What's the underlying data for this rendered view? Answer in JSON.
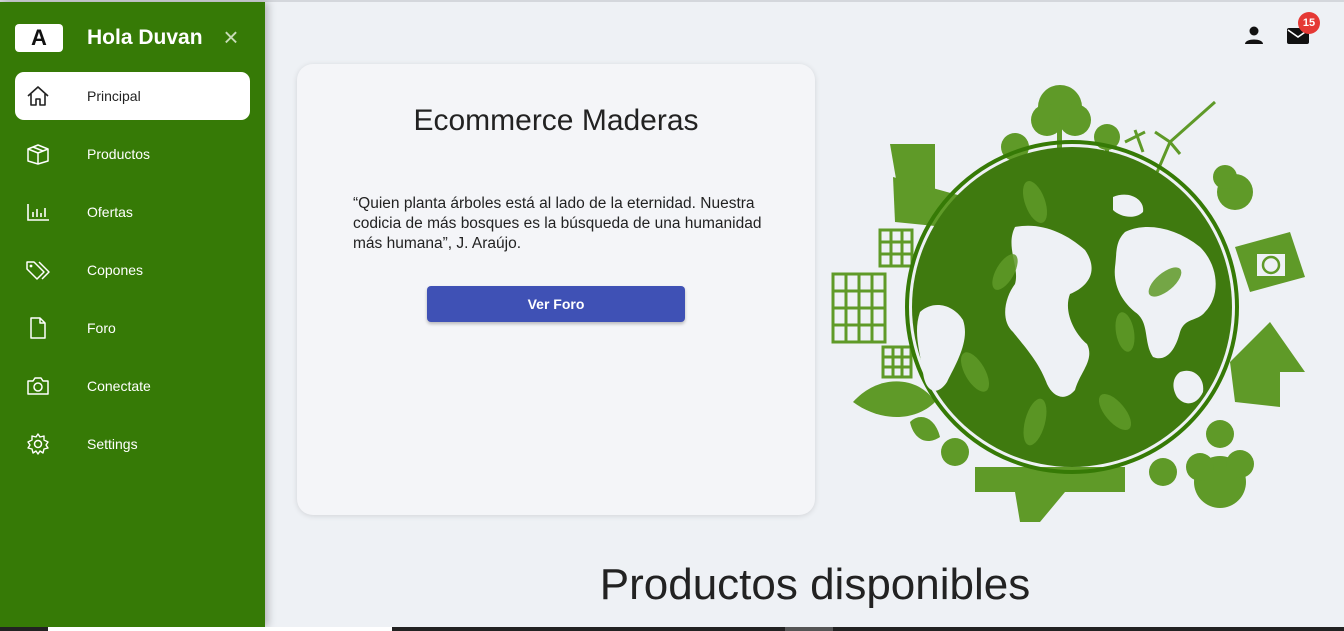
{
  "sidebar": {
    "logo": "A",
    "greeting": "Hola Duvan",
    "close_icon": "×",
    "items": [
      {
        "label": "Principal",
        "icon": "home-icon",
        "active": true
      },
      {
        "label": "Productos",
        "icon": "box-icon"
      },
      {
        "label": "Ofertas",
        "icon": "bar-chart-icon"
      },
      {
        "label": "Copones",
        "icon": "tags-icon"
      },
      {
        "label": "Foro",
        "icon": "document-icon"
      },
      {
        "label": "Conectate",
        "icon": "camera-icon"
      },
      {
        "label": "Settings",
        "icon": "gear-icon"
      }
    ],
    "color": "#367a06"
  },
  "header": {
    "user_icon": "user-icon",
    "mail_icon": "mail-icon",
    "mail_badge": "15"
  },
  "card": {
    "title": "Ecommerce Maderas",
    "quote": "“Quien planta árboles está al lado de la eternidad. Nuestra codicia de más bosques es la búsqueda de una humanidad más humana”, J. Araújo.",
    "button_label": "Ver Foro",
    "button_color": "#3f51b5"
  },
  "main": {
    "section_title": "Productos disponibles",
    "illustration": "green-earth-illustration"
  }
}
